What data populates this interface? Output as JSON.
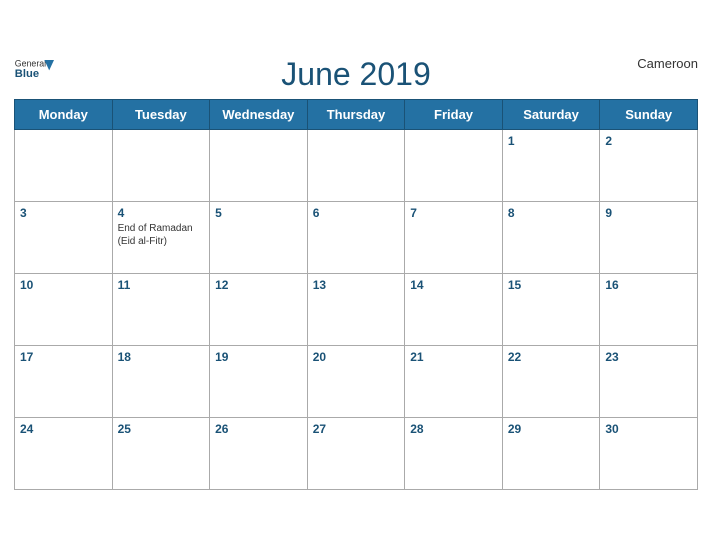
{
  "header": {
    "logo_general": "General",
    "logo_blue": "Blue",
    "title": "June 2019",
    "country": "Cameroon"
  },
  "days_of_week": [
    "Monday",
    "Tuesday",
    "Wednesday",
    "Thursday",
    "Friday",
    "Saturday",
    "Sunday"
  ],
  "weeks": [
    [
      {
        "day": "",
        "holiday": ""
      },
      {
        "day": "",
        "holiday": ""
      },
      {
        "day": "",
        "holiday": ""
      },
      {
        "day": "",
        "holiday": ""
      },
      {
        "day": "",
        "holiday": ""
      },
      {
        "day": "1",
        "holiday": ""
      },
      {
        "day": "2",
        "holiday": ""
      }
    ],
    [
      {
        "day": "3",
        "holiday": ""
      },
      {
        "day": "4",
        "holiday": "End of Ramadan (Eid al-Fitr)"
      },
      {
        "day": "5",
        "holiday": ""
      },
      {
        "day": "6",
        "holiday": ""
      },
      {
        "day": "7",
        "holiday": ""
      },
      {
        "day": "8",
        "holiday": ""
      },
      {
        "day": "9",
        "holiday": ""
      }
    ],
    [
      {
        "day": "10",
        "holiday": ""
      },
      {
        "day": "11",
        "holiday": ""
      },
      {
        "day": "12",
        "holiday": ""
      },
      {
        "day": "13",
        "holiday": ""
      },
      {
        "day": "14",
        "holiday": ""
      },
      {
        "day": "15",
        "holiday": ""
      },
      {
        "day": "16",
        "holiday": ""
      }
    ],
    [
      {
        "day": "17",
        "holiday": ""
      },
      {
        "day": "18",
        "holiday": ""
      },
      {
        "day": "19",
        "holiday": ""
      },
      {
        "day": "20",
        "holiday": ""
      },
      {
        "day": "21",
        "holiday": ""
      },
      {
        "day": "22",
        "holiday": ""
      },
      {
        "day": "23",
        "holiday": ""
      }
    ],
    [
      {
        "day": "24",
        "holiday": ""
      },
      {
        "day": "25",
        "holiday": ""
      },
      {
        "day": "26",
        "holiday": ""
      },
      {
        "day": "27",
        "holiday": ""
      },
      {
        "day": "28",
        "holiday": ""
      },
      {
        "day": "29",
        "holiday": ""
      },
      {
        "day": "30",
        "holiday": ""
      }
    ]
  ]
}
